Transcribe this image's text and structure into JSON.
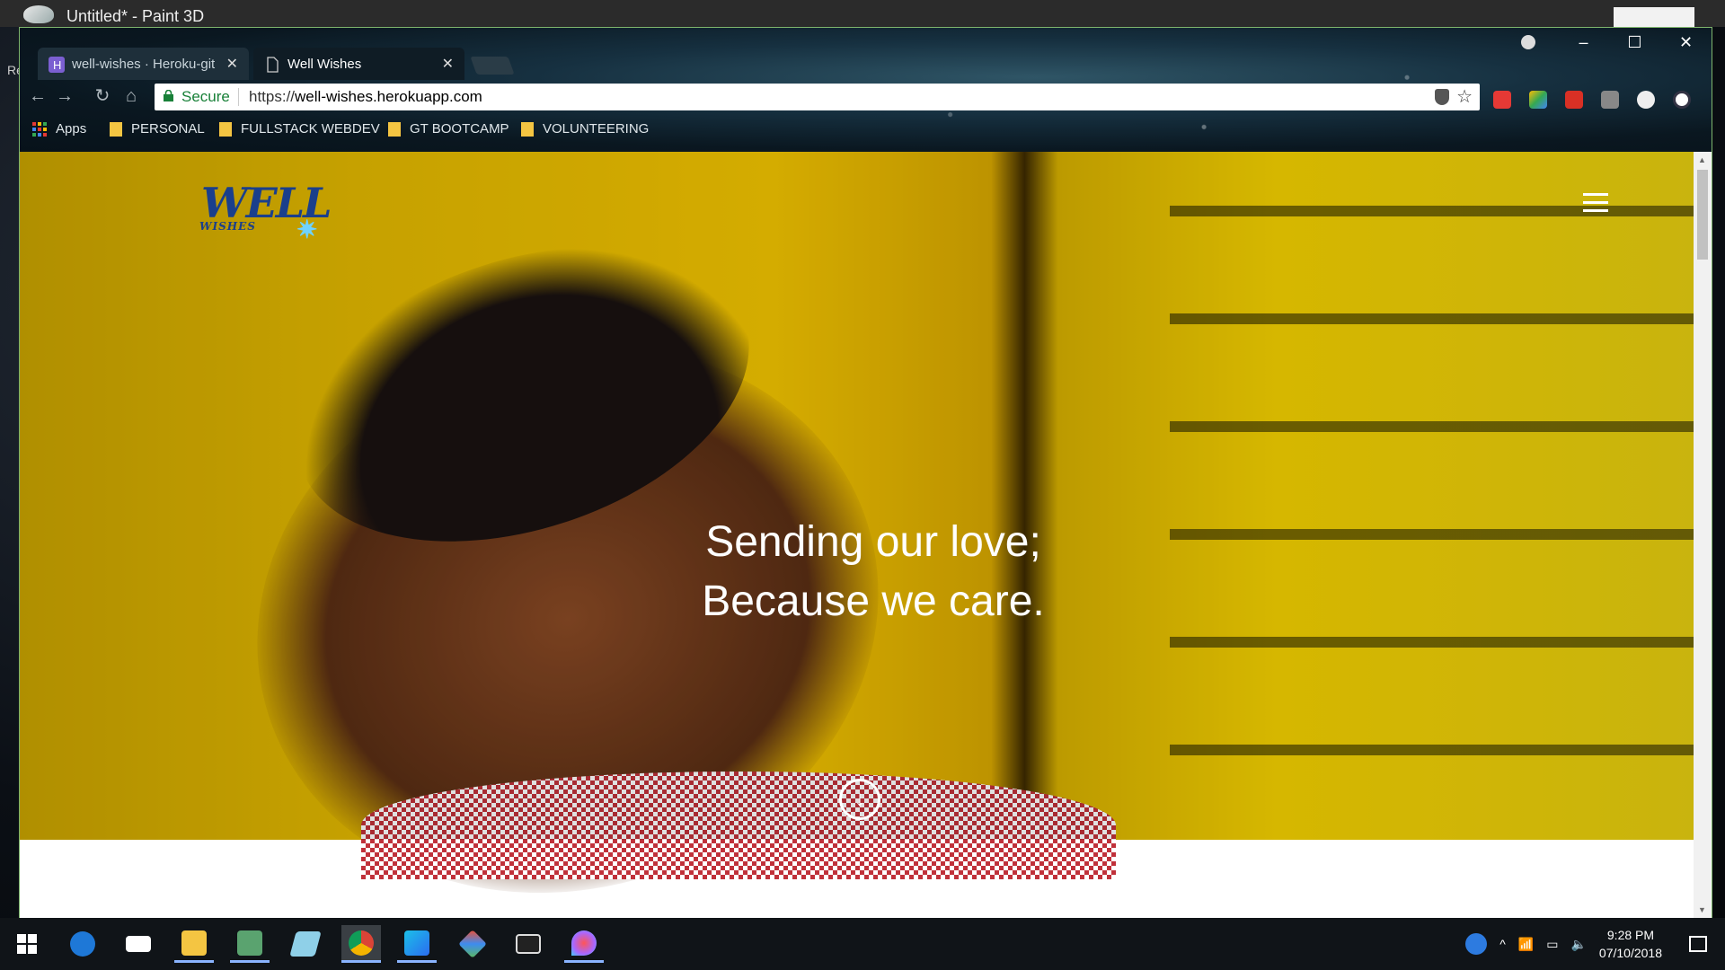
{
  "background_app": {
    "title": "Untitled* - Paint 3D",
    "side_letter": "Re"
  },
  "browser": {
    "tabs": [
      {
        "title": "well-wishes · Heroku-git",
        "active": false
      },
      {
        "title": "Well Wishes",
        "active": true
      }
    ],
    "omnibox": {
      "secure_label": "Secure",
      "url_scheme": "https://",
      "url_host": "well-wishes.herokuapp.com"
    },
    "bookmarks": [
      {
        "label": "Apps",
        "type": "apps"
      },
      {
        "label": "PERSONAL",
        "type": "folder"
      },
      {
        "label": "FULLSTACK WEBDEV",
        "type": "folder"
      },
      {
        "label": "GT BOOTCAMP",
        "type": "folder"
      },
      {
        "label": "VOLUNTEERING",
        "type": "folder"
      }
    ],
    "extensions": [
      "video-extension-icon",
      "google-drive-icon",
      "gmail-icon",
      "extension-icon",
      "circle-extension-icon",
      "blocker-extension-icon"
    ]
  },
  "page": {
    "logo": {
      "main": "WELL",
      "sub": "WISHES"
    },
    "tagline_line1": "Sending our love;",
    "tagline_line2": "Because we care."
  },
  "taskbar": {
    "apps": [
      "start",
      "edge",
      "mail",
      "file-explorer",
      "store-badge-app",
      "paint-3d-app",
      "chrome",
      "webstorm",
      "git-app",
      "terminal",
      "paint-3d"
    ],
    "clock": {
      "time": "9:28 PM",
      "date": "07/10/2018"
    }
  },
  "colors": {
    "accent_green": "#188038",
    "hero_yellow": "#f2c400",
    "logo_blue": "#1a3f8c"
  }
}
